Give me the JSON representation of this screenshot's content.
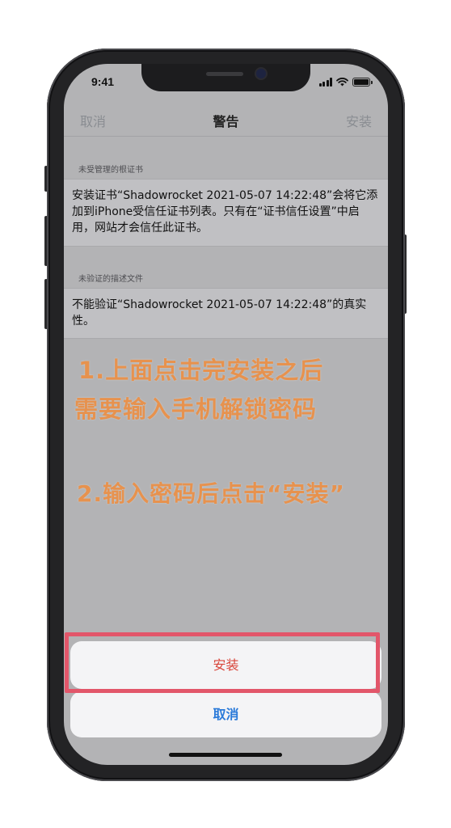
{
  "status_bar": {
    "time": "9:41",
    "icons": [
      "cellular-signal-icon",
      "wifi-icon",
      "battery-icon"
    ]
  },
  "navbar": {
    "cancel_label": "取消",
    "title": "警告",
    "install_label": "安装"
  },
  "sections": [
    {
      "header": "未受管理的根证书",
      "body": "安装证书“Shadowrocket 2021-05-07 14:22:48”会将它添加到iPhone受信任证书列表。只有在“证书信任设置”中启用，网站才会信任此证书。"
    },
    {
      "header": "未验证的描述文件",
      "body": "不能验证“Shadowrocket 2021-05-07 14:22:48”的真实性。"
    }
  ],
  "annotations": {
    "step1_line1": "1.上面点击完安装之后",
    "step1_line2": "需要输入手机解锁密码",
    "step2": "2.输入密码后点击“安装”",
    "color": "#e7924e",
    "highlight_color": "#e2566a"
  },
  "action_sheet": {
    "install_label": "安装",
    "cancel_label": "取消",
    "install_color": "#d9463b",
    "cancel_color": "#2a7ad9"
  }
}
